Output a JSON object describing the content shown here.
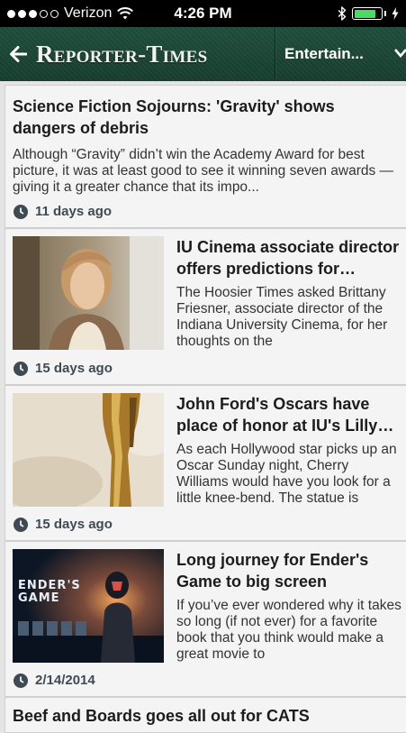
{
  "status_bar": {
    "carrier": "Verizon",
    "time": "4:26 PM",
    "signal_bars_filled": 3,
    "signal_bars_total": 5,
    "battery_level": 0.8
  },
  "header": {
    "logo": "Reporter-Times",
    "section": "Entertain..."
  },
  "articles": [
    {
      "title": "Science Fiction Sojourns: 'Gravity' shows dangers of debris",
      "summary": "Although “Gravity” didn’t win the Academy Award for best picture, it was at least good to see it winning seven awards — giving it a greater chance that its impo...",
      "time": "11 days ago"
    },
    {
      "title": "IU Cinema associate director offers predictions for…",
      "summary": "The Hoosier Times asked Brittany Friesner, associate director of the Indiana University Cinema, for her thoughts on the",
      "time": "15 days ago"
    },
    {
      "title": "John Ford's Oscars have place of honor at IU's Lilly…",
      "summary": "As each Hollywood star picks up an Oscar Sunday night, Cherry Williams would have you look for a little knee-bend. The statue is",
      "time": "15 days ago"
    },
    {
      "title": "Long journey for Ender's Game to big screen",
      "summary": "If you’ve ever wondered why it takes so long (if not ever) for a favorite book that you think would make a great movie to",
      "time": "2/14/2014",
      "image_text": "ENDER'S GAME"
    },
    {
      "title": "Beef and Boards goes all out for CATS"
    }
  ],
  "colors": {
    "header_bg": "#1f4e3b",
    "feed_bg": "#e4e4e4",
    "card_bg": "#f4f4f4",
    "battery": "#4cd964"
  }
}
